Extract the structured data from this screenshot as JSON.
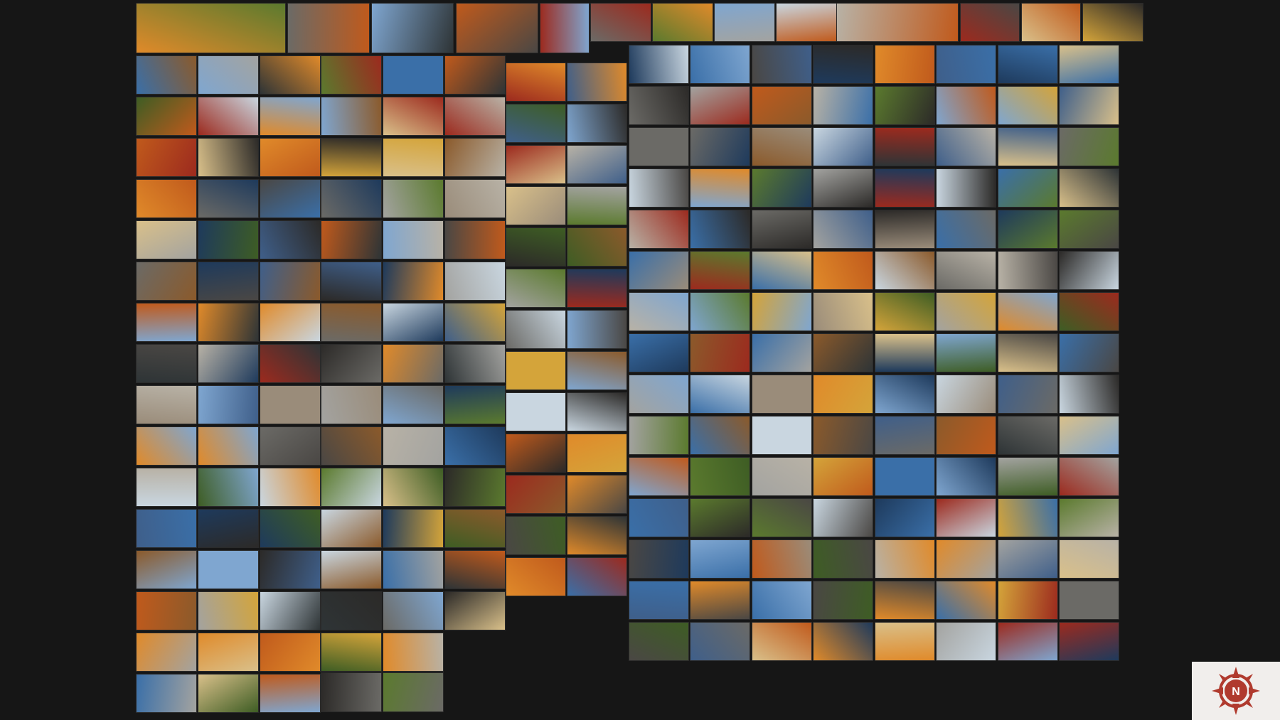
{
  "viewer": {
    "type": "photo-mosaic-gallery",
    "palette": [
      "#3f5f8a",
      "#7fa6d0",
      "#c9d6e0",
      "#b8b2a6",
      "#6b6a66",
      "#4a4744",
      "#2c2a28",
      "#8b5a2b",
      "#c05a1c",
      "#e08a2a",
      "#d4a43a",
      "#5b7a2e",
      "#3e5d24",
      "#9c2a1e",
      "#1e3a5c",
      "#3a6fa8",
      "#9a8c7a",
      "#2e3436",
      "#a3a3a0",
      "#d9c08a"
    ]
  },
  "branding": {
    "logo_icon": "compass-rose-icon",
    "logo_letter": "N",
    "logo_color": "#b03a2e"
  }
}
